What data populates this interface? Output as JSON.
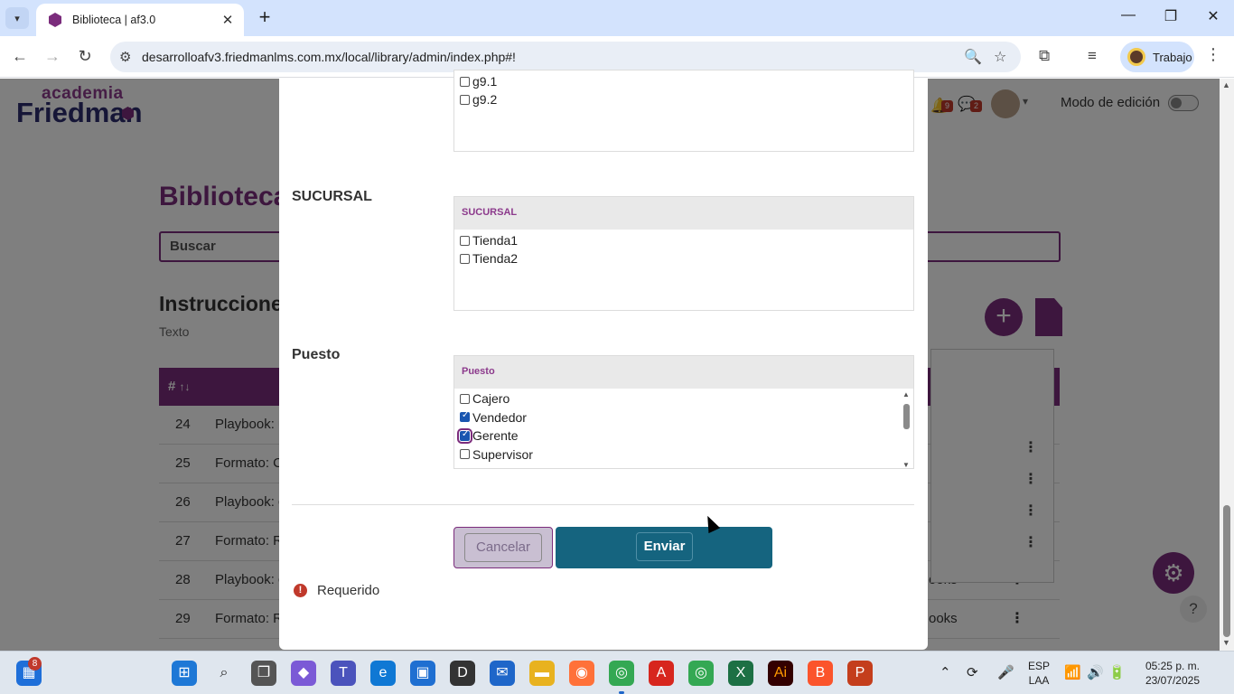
{
  "browser": {
    "tab_title": "Biblioteca | af3.0",
    "url": "desarrolloafv3.friedmanlms.com.mx/local/library/admin/index.php#!",
    "profile_label": "Trabajo"
  },
  "header": {
    "logo_top": "academia",
    "logo_bottom": "Friedman",
    "notif_count": "9",
    "msg_count": "2",
    "edit_mode_label": "Modo de edición"
  },
  "background": {
    "title": "Biblioteca",
    "search_placeholder": "Buscar",
    "section_title": "Instruccione",
    "section_sub": "Texto",
    "col_num": "#",
    "rows": [
      {
        "num": "24",
        "text": "Playbook: u",
        "tail": ""
      },
      {
        "num": "25",
        "text": "Formato: C",
        "tail": ""
      },
      {
        "num": "26",
        "text": "Playbook: c",
        "tail": ""
      },
      {
        "num": "27",
        "text": "Formato: R",
        "tail": ""
      },
      {
        "num": "28",
        "text": "Playbook: c",
        "tail": "ooks"
      },
      {
        "num": "29",
        "text": "Formato: R",
        "tail": "ooks"
      }
    ]
  },
  "modal": {
    "top_items": [
      {
        "label": "g9.1",
        "checked": false
      },
      {
        "label": "g9.2",
        "checked": false
      }
    ],
    "sucursal_label": "SUCURSAL",
    "sucursal_head": "SUCURSAL",
    "sucursal_items": [
      {
        "label": "Tienda1",
        "checked": false
      },
      {
        "label": "Tienda2",
        "checked": false
      }
    ],
    "puesto_label": "Puesto",
    "puesto_head": "Puesto",
    "puesto_items": [
      {
        "label": "Cajero",
        "checked": false
      },
      {
        "label": "Vendedor",
        "checked": true
      },
      {
        "label": "Gerente",
        "checked": true
      },
      {
        "label": "Supervisor",
        "checked": false
      }
    ],
    "cancel_label": "Cancelar",
    "submit_label": "Enviar",
    "required_label": "Requerido"
  },
  "taskbar": {
    "start_badge": "8",
    "lang_top": "ESP",
    "lang_bottom": "LAA",
    "time": "05:25 p. m.",
    "date": "23/07/2025"
  },
  "colors": {
    "brand": "#7b2c7c",
    "submit": "#15647f",
    "required": "#c0392b"
  }
}
